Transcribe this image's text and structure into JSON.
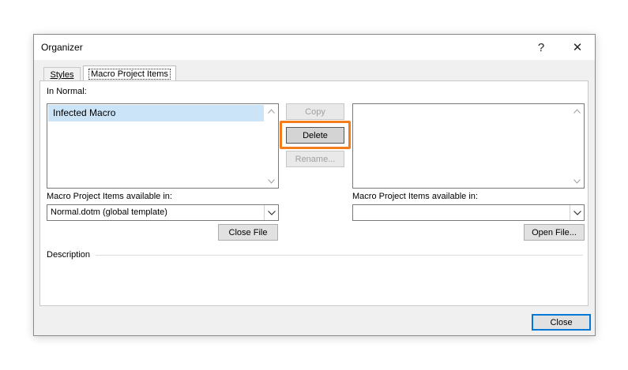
{
  "window": {
    "title": "Organizer",
    "help_glyph": "?",
    "close_glyph": "✕"
  },
  "tabs": [
    {
      "label": "Styles",
      "active": false
    },
    {
      "label": "Macro Project Items",
      "active": true
    }
  ],
  "left": {
    "list_label": "In Normal:",
    "items": [
      "Infected Macro"
    ],
    "selected_index": 0,
    "available_label": "Macro Project Items available in:",
    "available_value": "Normal.dotm (global template)",
    "file_button": "Close File"
  },
  "right": {
    "items": [],
    "available_label": "Macro Project Items available in:",
    "available_value": "",
    "file_button": "Open File..."
  },
  "actions": {
    "copy": "Copy",
    "delete": "Delete",
    "rename": "Rename..."
  },
  "description_label": "Description",
  "close_button": "Close",
  "colors": {
    "highlight": "#f47c1a",
    "selection": "#cce4f7",
    "default_button_border": "#0078d7"
  },
  "icons": {
    "scroll_up": "chevron-up-icon",
    "scroll_down": "chevron-down-icon",
    "combo_dropdown": "chevron-down-icon"
  }
}
